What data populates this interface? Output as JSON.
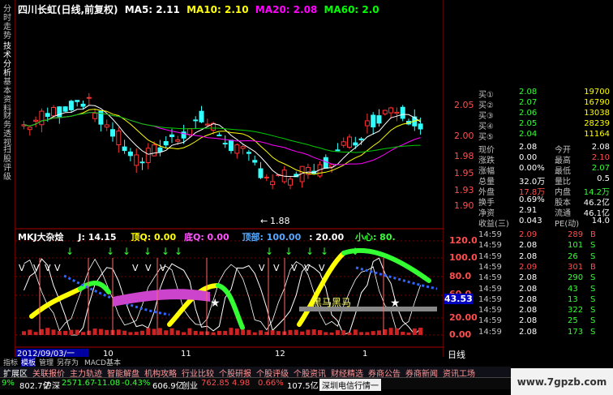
{
  "left_tabs": [
    "分时走势",
    "技术分析",
    "基本资料",
    "财务透视",
    "扫股评级"
  ],
  "header": {
    "stock": "四川长虹(日线,前复权)",
    "ma5": "MA5: 2.11",
    "ma10": "MA10: 2.10",
    "ma20": "MA20: 2.08",
    "ma60": "MA60: 2.0",
    "colors": {
      "ma5": "#ffffff",
      "ma10": "#ffff00",
      "ma20": "#ff00ff",
      "ma60": "#00ff00"
    }
  },
  "price_axis": [
    "2.05",
    "2.00",
    "1.98",
    "1.95",
    "1.93",
    "1.90"
  ],
  "low_label": "1.88",
  "indicator": {
    "name": "MKJ大杂烩",
    "j": "J: 14.15",
    "top_q": "顶Q: 0.00",
    "bottom_q": "底Q: 0.00",
    "top": "顶部: 100.00",
    "val20": ": 20.00",
    "careful": "小心: 80."
  },
  "indicator_axis": [
    "120.0",
    "100.0",
    "80.0",
    "60.0",
    "43.53",
    "20.00",
    "0.00"
  ],
  "annotation": "黑马黑马",
  "dates": {
    "current": "2012/09/03/一",
    "m10": "10",
    "m11": "11",
    "m12": "12",
    "m1": "1",
    "period": "日线"
  },
  "quote": {
    "buy": [
      {
        "label": "买①",
        "price": "2.08",
        "vol": "19700"
      },
      {
        "label": "买②",
        "price": "2.07",
        "vol": "16790"
      },
      {
        "label": "买③",
        "price": "2.06",
        "vol": "13038"
      },
      {
        "label": "买④",
        "price": "2.05",
        "vol": "28239"
      },
      {
        "label": "买⑤",
        "price": "2.04",
        "vol": "11164"
      }
    ],
    "stats": [
      {
        "l1": "现价",
        "v1": "2.08",
        "l2": "今开",
        "v2": "2.08"
      },
      {
        "l1": "涨跌",
        "v1": "0.00",
        "l2": "最高",
        "v2": "2.10"
      },
      {
        "l1": "涨幅",
        "v1": "0.00%",
        "l2": "最低",
        "v2": "2.07"
      },
      {
        "l1": "总量",
        "v1": "32.0万",
        "l2": "量比",
        "v2": "0.5"
      },
      {
        "l1": "外盘",
        "v1": "17.8万",
        "l2": "内盘",
        "v2": "14.2万"
      },
      {
        "l1": "换手",
        "v1": "0.69%",
        "l2": "股本",
        "v2": "46.2亿"
      },
      {
        "l1": "净资",
        "v1": "2.91",
        "l2": "流通",
        "v2": "46.1亿"
      },
      {
        "l1": "收益(三)",
        "v1": "0.043",
        "l2": "PE(动)",
        "v2": "14.0"
      }
    ],
    "ticks": [
      {
        "time": "14:59",
        "price": "2.09",
        "vol": "289",
        "side": "B"
      },
      {
        "time": "14:59",
        "price": "2.08",
        "vol": "101",
        "side": "S"
      },
      {
        "time": "14:59",
        "price": "2.08",
        "vol": "26",
        "side": "S"
      },
      {
        "time": "14:59",
        "price": "2.09",
        "vol": "301",
        "side": "B"
      },
      {
        "time": "14:59",
        "price": "2.08",
        "vol": "290",
        "side": "S"
      },
      {
        "time": "14:59",
        "price": "2.08",
        "vol": "43",
        "side": "S"
      },
      {
        "time": "14:59",
        "price": "2.08",
        "vol": "13",
        "side": "S"
      },
      {
        "time": "14:59",
        "price": "2.08",
        "vol": "322",
        "side": "S"
      },
      {
        "time": "14:59",
        "price": "2.08",
        "vol": "25",
        "side": "S"
      },
      {
        "time": "14:59",
        "price": "2.08",
        "vol": "173",
        "side": "S"
      }
    ]
  },
  "toolbar1": [
    "指标",
    "模板",
    "管理",
    "另存为",
    "MACD基本"
  ],
  "toolbar2": [
    "扩展区",
    "关联报价",
    "主力轨迹",
    "智能解盘",
    "机构攻略",
    "行业比较",
    "个股研报",
    "个股评级",
    "个股资讯",
    "财经精选",
    "券商公告",
    "券商新闻",
    "资讯工场"
  ],
  "status": [
    "9%",
    "802.7亿",
    "沪深",
    "2571.67",
    "-11.08",
    "-0.43%",
    "606.9亿",
    "创业",
    "762.85",
    "4.98",
    "0.66%",
    "107.5亿",
    "深圳电信行情一"
  ],
  "watermark": "www.7gpzb.com"
}
